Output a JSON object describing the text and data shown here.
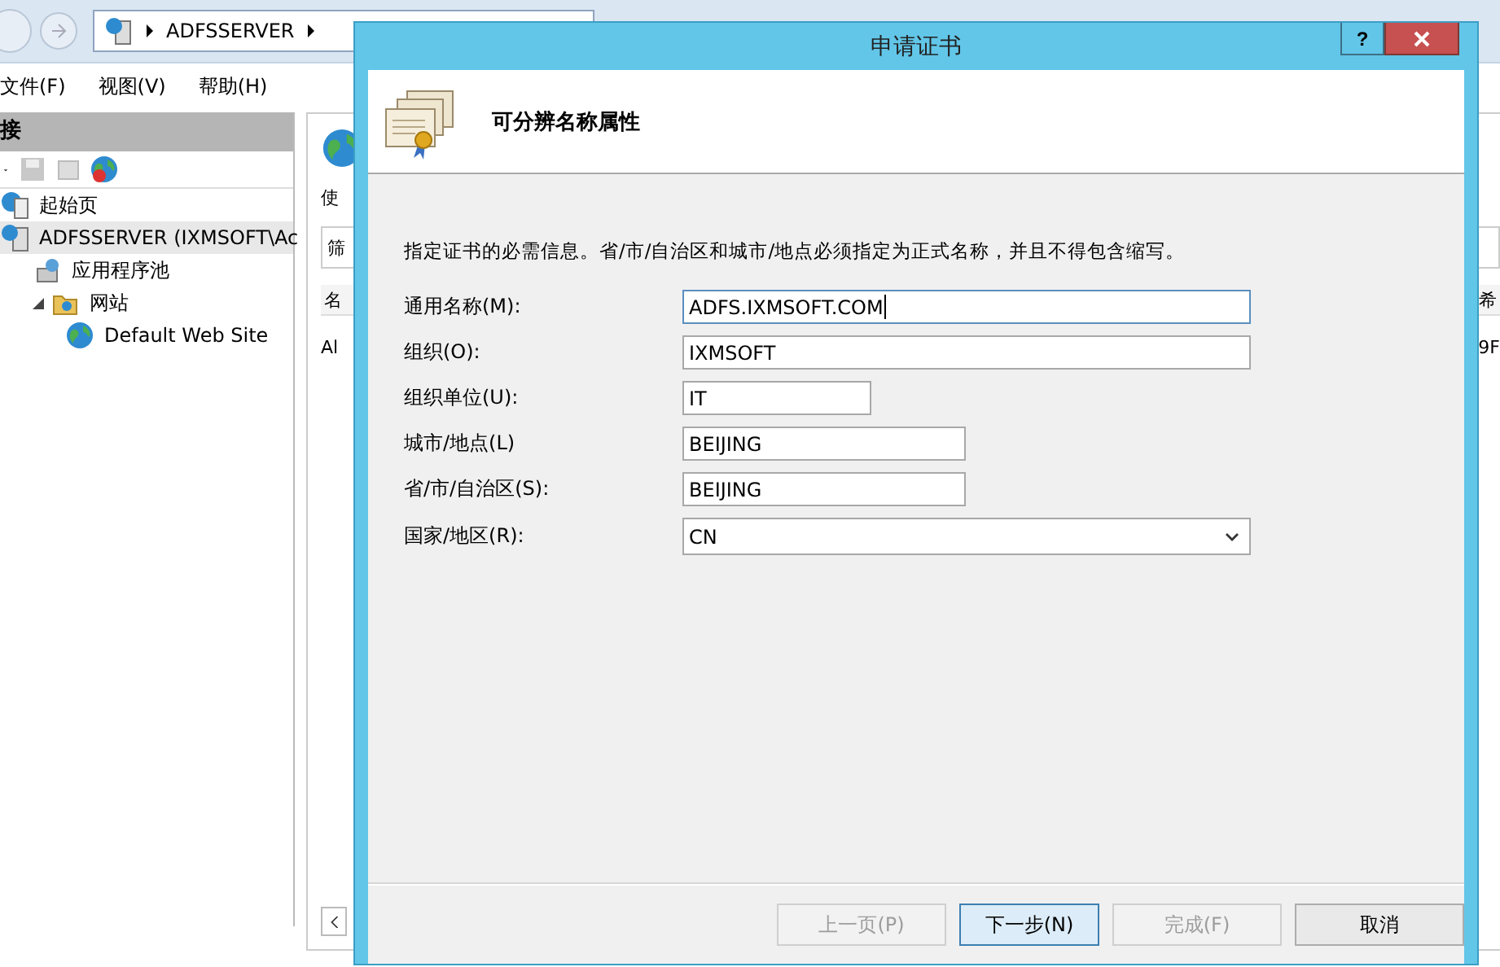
{
  "background": {
    "address_bar": {
      "crumbs": [
        "ADFSSERVER"
      ]
    },
    "menu": [
      "文件(F)",
      "视图(V)",
      "帮助(H)"
    ],
    "connections": {
      "title": "接",
      "tree": [
        {
          "label": "起始页",
          "kind": "start",
          "selected": false
        },
        {
          "label": "ADFSSERVER (IXMSOFT\\Ac",
          "kind": "server",
          "selected": true,
          "children": [
            {
              "label": "应用程序池",
              "kind": "pool",
              "selected": false
            },
            {
              "label": "网站",
              "kind": "folder",
              "selected": false,
              "expanded": true,
              "children": [
                {
                  "label": "Default Web Site",
                  "kind": "site",
                  "selected": false
                }
              ]
            }
          ]
        }
      ]
    },
    "content": {
      "label": "使",
      "filter": "筛",
      "column_1": "名",
      "row_1": "Al",
      "column_2": "希",
      "row_2": "9F"
    }
  },
  "dialog": {
    "title": "申请证书",
    "help": "?",
    "header": "可分辨名称属性",
    "instruction": "指定证书的必需信息。省/市/自治区和城市/地点必须指定为正式名称，并且不得包含缩写。",
    "fields": [
      {
        "label": "通用名称(M):",
        "kind": "text",
        "value": "ADFS.IXMSOFT.COM",
        "focused": true
      },
      {
        "label": "组织(O):",
        "kind": "text",
        "value": "IXMSOFT",
        "focused": false
      },
      {
        "label": "组织单位(U):",
        "kind": "text",
        "value": "IT",
        "focused": false
      },
      {
        "label": "城市/地点(L)",
        "kind": "text",
        "value": "BEIJING",
        "focused": false
      },
      {
        "label": "省/市/自治区(S):",
        "kind": "text",
        "value": "BEIJING",
        "focused": false
      },
      {
        "label": "国家/地区(R):",
        "kind": "select",
        "value": "CN",
        "focused": false
      }
    ],
    "buttons": [
      {
        "label": "上一页(P)",
        "disabled": true,
        "selected": false
      },
      {
        "label": "下一步(N)",
        "disabled": false,
        "selected": true
      },
      {
        "label": "完成(F)",
        "disabled": true,
        "selected": false
      },
      {
        "label": "取消",
        "disabled": false,
        "selected": false
      }
    ]
  }
}
